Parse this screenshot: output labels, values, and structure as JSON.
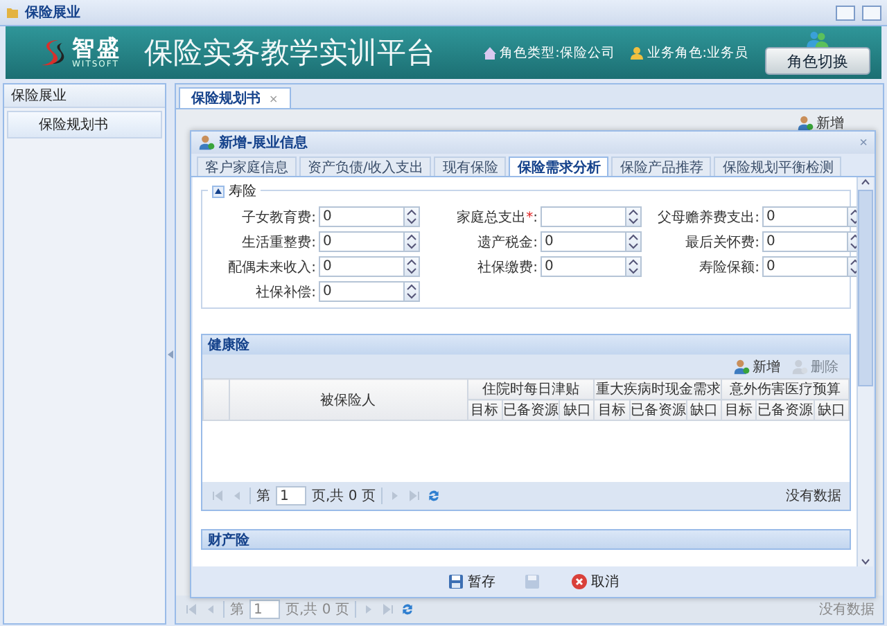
{
  "window": {
    "title": "保险展业"
  },
  "header": {
    "logo_name": "智盛",
    "logo_sub": "WITSOFT",
    "platform_title": "保险实务教学实训平台",
    "role_type": "角色类型:保险公司",
    "business_role": "业务角色:业务员",
    "switch_button": "角色切换"
  },
  "sidebar": {
    "group": "保险展业",
    "items": [
      {
        "label": "保险规划书",
        "selected": true
      }
    ]
  },
  "tabs": [
    {
      "label": "保险规划书",
      "selected": true,
      "close": "×"
    }
  ],
  "toolbar": {
    "add_button": "新增"
  },
  "background_pager": {
    "page_prefix": "第",
    "page": "1",
    "page_suffix": "页,共 0 页",
    "status": "没有数据"
  },
  "dialog": {
    "title": "新增-展业信息",
    "close": "×",
    "tabs": [
      {
        "label": "客户家庭信息",
        "selected": false
      },
      {
        "label": "资产负债/收入支出",
        "selected": false
      },
      {
        "label": "现有保险",
        "selected": false
      },
      {
        "label": "保险需求分析",
        "selected": true
      },
      {
        "label": "保险产品推荐",
        "selected": false
      },
      {
        "label": "保险规划平衡检测",
        "selected": false
      }
    ],
    "fieldset": {
      "legend": "寿险",
      "expanded": true
    },
    "required_marker": "*",
    "label_suffix": ":",
    "fields": [
      {
        "label": "子女教育费",
        "value": "0",
        "required": false
      },
      {
        "label": "家庭总支出",
        "required": true
      },
      {
        "label": "父母赡养费支出",
        "value": "0",
        "required": false
      },
      {
        "label": "生活重整费",
        "value": "0",
        "required": false
      },
      {
        "label": "遗产税金",
        "value": "0",
        "required": false
      },
      {
        "label": "最后关怀费",
        "value": "0",
        "required": false
      },
      {
        "label": "配偶未来收入",
        "value": "0",
        "required": false
      },
      {
        "label": "社保缴费",
        "value": "0",
        "required": false
      },
      {
        "label": "寿险保额",
        "value": "0",
        "required": false
      },
      {
        "label": "社保补偿",
        "value": "0",
        "required": false
      }
    ],
    "health": {
      "title": "健康险",
      "add_button": "新增",
      "delete_button": {
        "label": "删除",
        "disabled": true
      },
      "insured_column": "被保险人",
      "groups": [
        {
          "label": "住院时每日津贴",
          "columns": [
            "目标",
            "已备资源",
            "缺口"
          ]
        },
        {
          "label": "重大疾病时现金需求",
          "columns": [
            "目标",
            "已备资源",
            "缺口"
          ]
        },
        {
          "label": "意外伤害医疗预算",
          "columns": [
            "目标",
            "已备资源",
            "缺口"
          ]
        }
      ],
      "pager": {
        "page_prefix": "第",
        "page": "1",
        "page_suffix": "页,共 0 页",
        "status": "没有数据"
      }
    },
    "property": {
      "title": "财产险"
    },
    "buttons": [
      {
        "label": "暂存",
        "kind": "save",
        "disabled": false
      },
      {
        "kind": "submit",
        "disabled": true
      },
      {
        "label": "取消",
        "kind": "cancel",
        "disabled": false
      }
    ]
  }
}
